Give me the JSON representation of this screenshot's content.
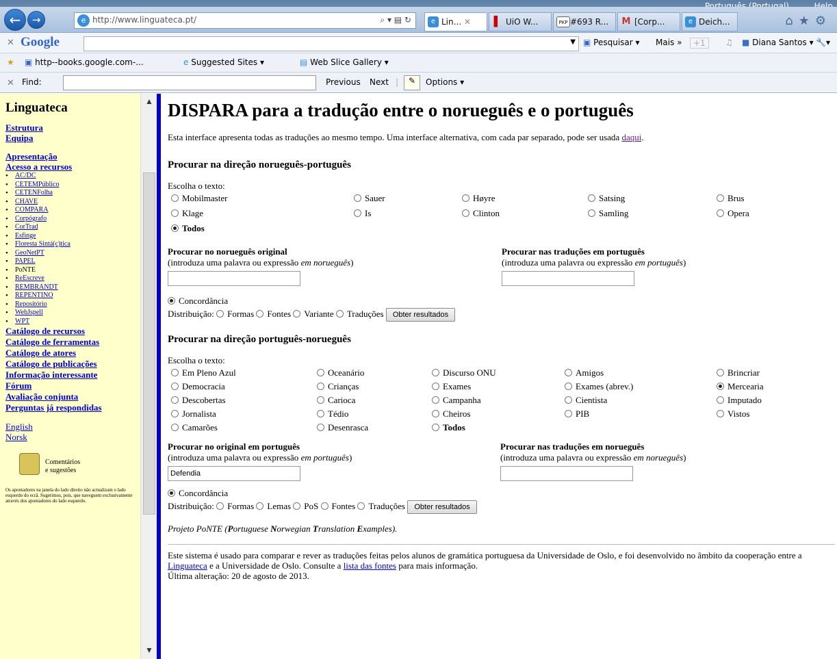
{
  "browser": {
    "lang_menu": "Português (Portugal)",
    "help": "Help",
    "address": "http://www.linguateca.pt/",
    "tabs": [
      {
        "label": "Lin...",
        "active": true
      },
      {
        "label": "UiO W...",
        "active": false
      },
      {
        "label": "#693 R...",
        "active": false
      },
      {
        "label": "[Corp...",
        "active": false
      },
      {
        "label": "Deich...",
        "active": false
      }
    ],
    "google": {
      "logo": "Google",
      "search_btn": "Pesquisar",
      "more": "Mais »",
      "plus": "+1",
      "user": "Diana Santos"
    },
    "favorites": {
      "item1": "http--books.google.com-...",
      "item2": "Suggested Sites",
      "item3": "Web Slice Gallery"
    },
    "find": {
      "label": "Find:",
      "prev": "Previous",
      "next": "Next",
      "options": "Options"
    }
  },
  "sidebar": {
    "title": "Linguateca",
    "group1": [
      "Estrutura",
      "Equipa"
    ],
    "group2": [
      "Apresentação",
      "Acesso a recursos"
    ],
    "resources": [
      "AC/DC",
      "CETEMPúblico",
      "CETENFolha",
      "CHAVE",
      "COMPARA",
      "Corpógrafo",
      "CorTrad",
      "Esfinge",
      "Floresta Sintá(c)tica",
      "GeoNetPT",
      "PAPEL",
      "PoNTE",
      "ReEscreve",
      "REMBRANDT",
      "REPENTINO",
      "Repositório",
      "WebJspell",
      "WPT"
    ],
    "catalogs": [
      "Catálogo de recursos",
      "Catálogo de ferramentas",
      "Catálogo de atores",
      "Catálogo de publicações",
      "Informação interessante",
      "Fórum",
      "Avaliação conjunta",
      "Perguntas já respondidas"
    ],
    "languages": [
      "English",
      "Norsk"
    ],
    "comments_line1": "Comentários",
    "comments_line2": "e sugestões",
    "note": "Os apontadores na janela do lado direito não actualizam o lado esquerdo do ecrã. Sugerimos, pois, que naveguem exclusivamente através dos apontadores do lado esquerdo."
  },
  "main": {
    "title": "DISPARA para a tradução entre o norueguês e o português",
    "intro": "Esta interface apresenta todas as traduções ao mesmo tempo. Uma interface alternativa, com cada par separado, pode ser usada ",
    "intro_link": "daqui",
    "intro_end": ".",
    "sec1": {
      "heading": "Procurar na direção norueguês-português",
      "choose": "Escolha o texto:",
      "texts": [
        "Mobilmaster",
        "Sauer",
        "Høyre",
        "Satsing",
        "Brus",
        "Klage",
        "Is",
        "Clinton",
        "Samling",
        "Opera"
      ],
      "all": "Todos",
      "orig_title": "Procurar no norueguês original",
      "orig_sub_a": "(introduza uma palavra ou expressão ",
      "orig_sub_em": "em norueguês",
      "orig_sub_b": ")",
      "trans_title": "Procurar nas traduções em português",
      "trans_sub_a": "(introduza uma palavra ou expressão ",
      "trans_sub_em": "em português",
      "trans_sub_b": ")",
      "orig_value": "",
      "trans_value": "",
      "concordance": "Concordância",
      "dist_label": "Distribuição:",
      "dist": [
        "Formas",
        "Fontes",
        "Variante",
        "Traduções"
      ],
      "submit": "Obter resultados"
    },
    "sec2": {
      "heading": "Procurar na direção português-norueguês",
      "choose": "Escolha o texto:",
      "texts": [
        "Em Pleno Azul",
        "Oceanário",
        "Discurso ONU",
        "Amigos",
        "Brincriar",
        "Democracia",
        "Crianças",
        "Exames",
        "Exames (abrev.)",
        "Mercearia",
        "Descobertas",
        "Carioca",
        "Campanha",
        "Cientista",
        "Imputado",
        "Jornalista",
        "Tédio",
        "Cheiros",
        "PIB",
        "Vistos",
        "Camarões",
        "Desenrasca"
      ],
      "all": "Todos",
      "orig_title": "Procurar no original em português",
      "orig_sub_a": "(introduza uma palavra ou expressão ",
      "orig_sub_em": "em português",
      "orig_sub_b": ")",
      "trans_title": "Procurar nas traduções em norueguês",
      "trans_sub_a": "(introduza uma palavra ou expressão ",
      "trans_sub_em": "em norueguês",
      "trans_sub_b": ")",
      "orig_value": "Defendia",
      "trans_value": "",
      "concordance": "Concordância",
      "dist_label": "Distribuição:",
      "dist": [
        "Formas",
        "Lemas",
        "PoS",
        "Fontes",
        "Traduções"
      ],
      "submit": "Obter resultados"
    },
    "project": {
      "a": "Projeto PoNTE (",
      "b1": "P",
      "t1": "ortuguese ",
      "b2": "N",
      "t2": "orwegian ",
      "b3": "T",
      "t3": "ranslation ",
      "b4": "E",
      "t4": "xamples",
      "c": ")."
    },
    "footer": {
      "p1": "Este sistema é usado para comparar e rever as traduções feitas pelos alunos de gramática portuguesa da Universidade de Oslo, e foi desenvolvido no âmbito da cooperação entre a ",
      "link1": "Linguateca",
      "p2": " e a Universidade de Oslo. Consulte a ",
      "link2": "lista das fontes",
      "p3": " para mais informação.",
      "updated": "Última alteração: 20 de agosto de 2013."
    }
  }
}
